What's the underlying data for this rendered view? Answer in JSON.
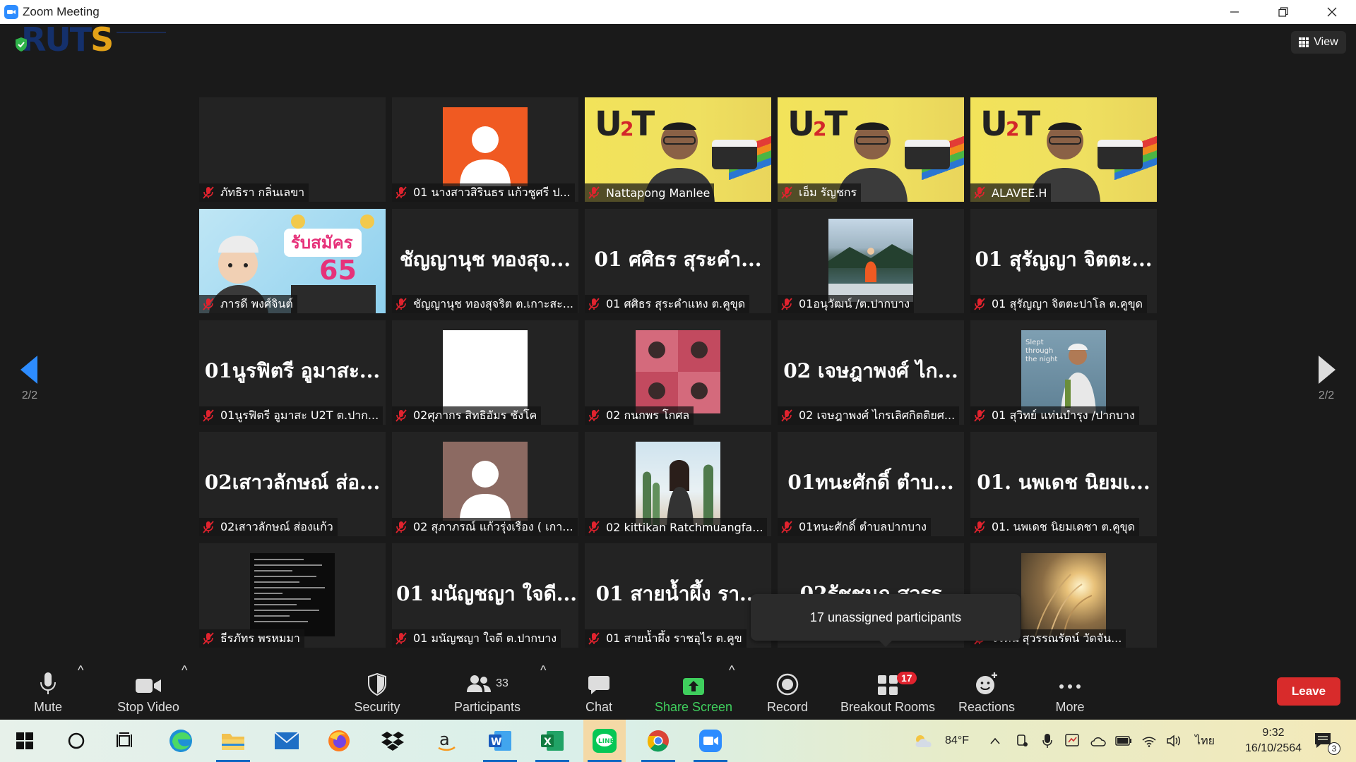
{
  "window": {
    "title": "Zoom Meeting"
  },
  "header": {
    "view_label": "View"
  },
  "pagination": {
    "prev_page": "2/2",
    "next_page": "2/2"
  },
  "tiles": [
    {
      "name": "ภัทธิรา กลิ่นเลขา",
      "big": "",
      "kind": "blank"
    },
    {
      "name": "01 นางสาวสิรินธร แก้วชูศรี ป...",
      "big": "",
      "kind": "avatar-orange"
    },
    {
      "name": "Nattapong Manlee",
      "big": "",
      "kind": "u2t"
    },
    {
      "name": "เอ็ม รัญชกร",
      "big": "",
      "kind": "u2t"
    },
    {
      "name": "ALAVEE.H",
      "big": "",
      "kind": "u2t"
    },
    {
      "name": "ภารดี พงศ์จินต์",
      "big": "",
      "kind": "poster"
    },
    {
      "name": "ชัญญานุช ทองสุจริต ต.เกาะสะ...",
      "big": "ชัญญานุช ทองสุจ...",
      "kind": "text"
    },
    {
      "name": "01 ศศิธร สุระคำแหง ต.คูขุด",
      "big": "01 ศศิธร สุระคำ...",
      "kind": "text"
    },
    {
      "name": "01อนุวัฒน์ /ต.ปากบาง",
      "big": "",
      "kind": "photo-lake"
    },
    {
      "name": "01 สุรัญญา จิตตะปาโล ต.คูขุด",
      "big": "01 สุรัญญา จิตตะ...",
      "kind": "text"
    },
    {
      "name": "01นูรฟิตรี อูมาสะ U2T ต.ปาก...",
      "big": "01นูรฟิตรี อูมาสะ...",
      "kind": "text"
    },
    {
      "name": "02ศุภากร สิทธิอัมร ชังโค",
      "big": "",
      "kind": "white"
    },
    {
      "name": "02 กนกพร โกศล",
      "big": "",
      "kind": "photo-grid"
    },
    {
      "name": "02 เจษฎาพงศ์ ไกรเลิศกิตติยศ...",
      "big": "02 เจษฎาพงศ์ ไก...",
      "kind": "text"
    },
    {
      "name": "01 สุวิทย์ แท่นบำรุง /ปากบาง",
      "big": "",
      "kind": "photo-wall"
    },
    {
      "name": "02เสาวลักษณ์ ส่องแก้ว",
      "big": "02เสาวลักษณ์ ส่อ...",
      "kind": "text"
    },
    {
      "name": "02 สุภาภรณ์ แก้วรุ่งเรือง ( เกา...",
      "big": "",
      "kind": "avatar-brown"
    },
    {
      "name": "02 kittikan Ratchmuangfa...",
      "big": "",
      "kind": "photo-cactus"
    },
    {
      "name": "01ทนะศักดิ์ ตำบลปากบาง",
      "big": "01ทนะศักดิ์ ตำบ...",
      "kind": "text"
    },
    {
      "name": "01. นพเดช นิยมเดชา ต.คูขุด",
      "big": "01. นพเดช นิยมเ...",
      "kind": "text"
    },
    {
      "name": "ธีรภัทร พรหมมา",
      "big": "",
      "kind": "photo-terminal"
    },
    {
      "name": "01 มนัญชญา ใจดี ต.ปากบาง",
      "big": "01 มนัญชญา ใจดี...",
      "kind": "text"
    },
    {
      "name": "01 สายน้ำผึ้ง ราชอุไร ต.คูข",
      "big": "01 สายน้ำผึ้ง รา...",
      "kind": "text"
    },
    {
      "name": "",
      "big": "02รัชชนก สุวรร",
      "kind": "text"
    },
    {
      "name": "รีรัตน์ สุวรรณรัตน์ วัดจัน...",
      "big": "",
      "kind": "photo-sunset"
    }
  ],
  "tooltip": {
    "text": "17 unassigned participants"
  },
  "toolbar": {
    "mute": "Mute",
    "stop_video": "Stop Video",
    "security": "Security",
    "participants": "Participants",
    "participants_count": "33",
    "chat": "Chat",
    "share_screen": "Share Screen",
    "record": "Record",
    "breakout_rooms": "Breakout Rooms",
    "breakout_badge": "17",
    "reactions": "Reactions",
    "more": "More",
    "leave": "Leave"
  },
  "taskbar": {
    "weather": "84°F",
    "language": "ไทย",
    "time": "9:32",
    "date": "16/10/2564",
    "notifications": "3"
  },
  "colors": {
    "accent_green": "#3fcf5d",
    "leave_red": "#d82b2b",
    "badge_red": "#e0232e",
    "zoom_blue": "#2d8cff"
  }
}
